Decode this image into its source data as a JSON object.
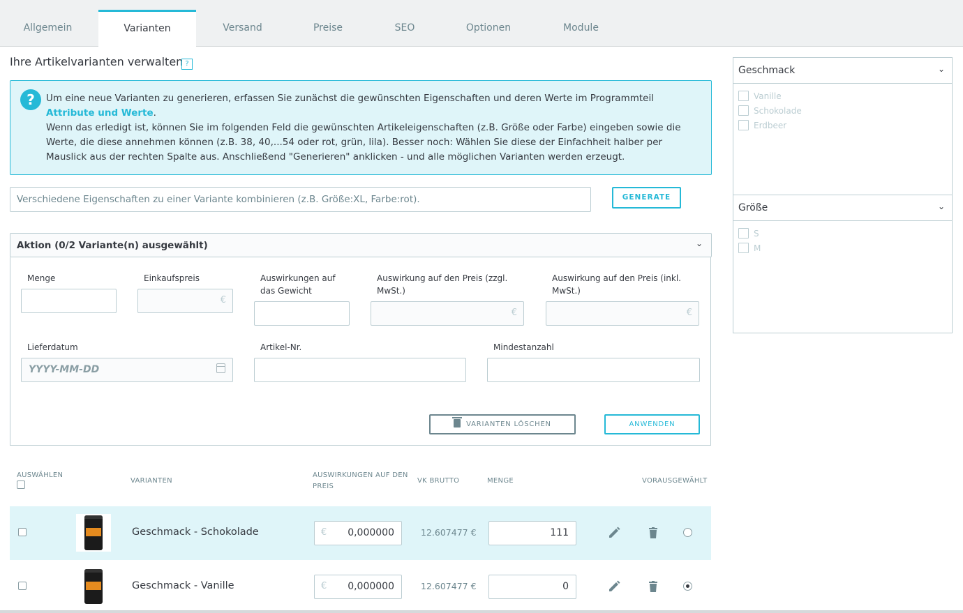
{
  "tabs": [
    "Allgemein",
    "Varianten",
    "Versand",
    "Preise",
    "SEO",
    "Optionen",
    "Module"
  ],
  "active_tab": "Varianten",
  "section_title": "Ihre Artikelvarianten verwalten",
  "help_icon": "?",
  "info": {
    "line1_pre": "Um eine neue Varianten zu generieren, erfassen Sie zunächst die gewünschten Eigenschaften und deren Werte im Programmteil ",
    "link": "Attribute und Werte",
    "line1_post": ".",
    "line2": "Wenn das erledigt ist, können Sie im folgenden Feld die gewünschten Artikeleigenschaften (z.B. Größe oder Farbe) eingeben sowie die Werte, die diese annehmen können (z.B. 38, 40,...54 oder rot, grün, lila). Besser noch: Wählen Sie diese der Einfachheit halber per Mauslick aus der rechten Spalte aus. Anschließend \"Generieren\" anklicken - und alle möglichen Varianten werden erzeugt."
  },
  "generator": {
    "placeholder": "Verschiedene Eigenschaften zu einer Variante kombinieren (z.B. Größe:XL, Farbe:rot).",
    "button": "GENERATE"
  },
  "bulk": {
    "header": "Aktion (0/2 Variante(n) ausgewählt)",
    "fields": {
      "quantity": "Menge",
      "cost_price": "Einkaufspreis",
      "weight_impact": "Auswirkungen auf das Gewicht",
      "price_impact_excl": "Auswirkung auf den Preis (zzgl. MwSt.)",
      "price_impact_incl": "Auswirkung auf den Preis (inkl. MwSt.)",
      "delivery_date": "Lieferdatum",
      "reference": "Artikel-Nr.",
      "min_quantity": "Mindestanzahl"
    },
    "currency": "€",
    "date_placeholder": "YYYY-MM-DD",
    "delete_button": "VARIANTEN LÖSCHEN",
    "apply_button": "ANWENDEN"
  },
  "table": {
    "headers": {
      "select": "AUSWÄHLEN",
      "variants": "VARIANTEN",
      "price_impact": "AUSWIRKUNGEN AUF DEN PREIS",
      "vk_brutto": "VK BRUTTO",
      "quantity": "MENGE",
      "default": "VORAUSGEWÄHLT"
    },
    "rows": [
      {
        "name": "Geschmack - Schokolade",
        "currency": "€",
        "price_impact": "0,000000",
        "vk_brutto": "12.607477 €",
        "quantity": "111",
        "default": false,
        "highlighted": true
      },
      {
        "name": "Geschmack - Vanille",
        "currency": "€",
        "price_impact": "0,000000",
        "vk_brutto": "12.607477 €",
        "quantity": "0",
        "default": true,
        "highlighted": false
      }
    ]
  },
  "attributes": [
    {
      "name": "Geschmack",
      "values": [
        "Vanille",
        "Schokolade",
        "Erdbeer"
      ]
    },
    {
      "name": "Größe",
      "values": [
        "S",
        "M"
      ]
    }
  ]
}
